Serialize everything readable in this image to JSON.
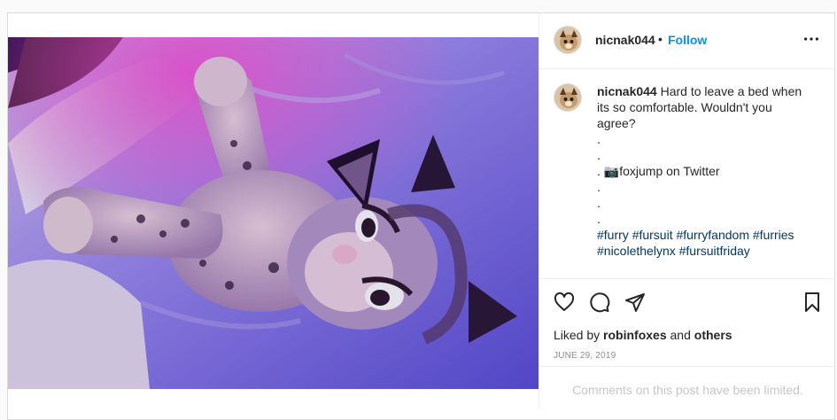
{
  "post": {
    "username": "nicnak044",
    "separator": "•",
    "follow_label": "Follow",
    "more_icon": "more-horizontal-icon",
    "caption": {
      "username": "nicnak044",
      "text": "Hard to leave a bed when its so comfortable. Wouldn't you agree?",
      "dots": [
        ".",
        ".",
        "."
      ],
      "credit_emoji": "📷",
      "credit_text": "foxjump on Twitter",
      "dots_after": [
        ".",
        ".",
        "."
      ],
      "hashtags": [
        "#furry",
        "#fursuit",
        "#furryfandom",
        "#furries",
        "#nicolethelynx",
        "#fursuitfriday"
      ]
    },
    "actions": {
      "like_icon": "heart-icon",
      "comment_icon": "comment-icon",
      "share_icon": "paper-plane-icon",
      "save_icon": "bookmark-icon"
    },
    "likes": {
      "prefix": "Liked by",
      "user": "robinfoxes",
      "and": "and",
      "others": "others"
    },
    "date": "JUNE 29, 2019",
    "comments_limited": "Comments on this post have been limited."
  },
  "colors": {
    "link": "#0095f6",
    "hashtag": "#00376b",
    "muted": "#8e8e8e"
  }
}
